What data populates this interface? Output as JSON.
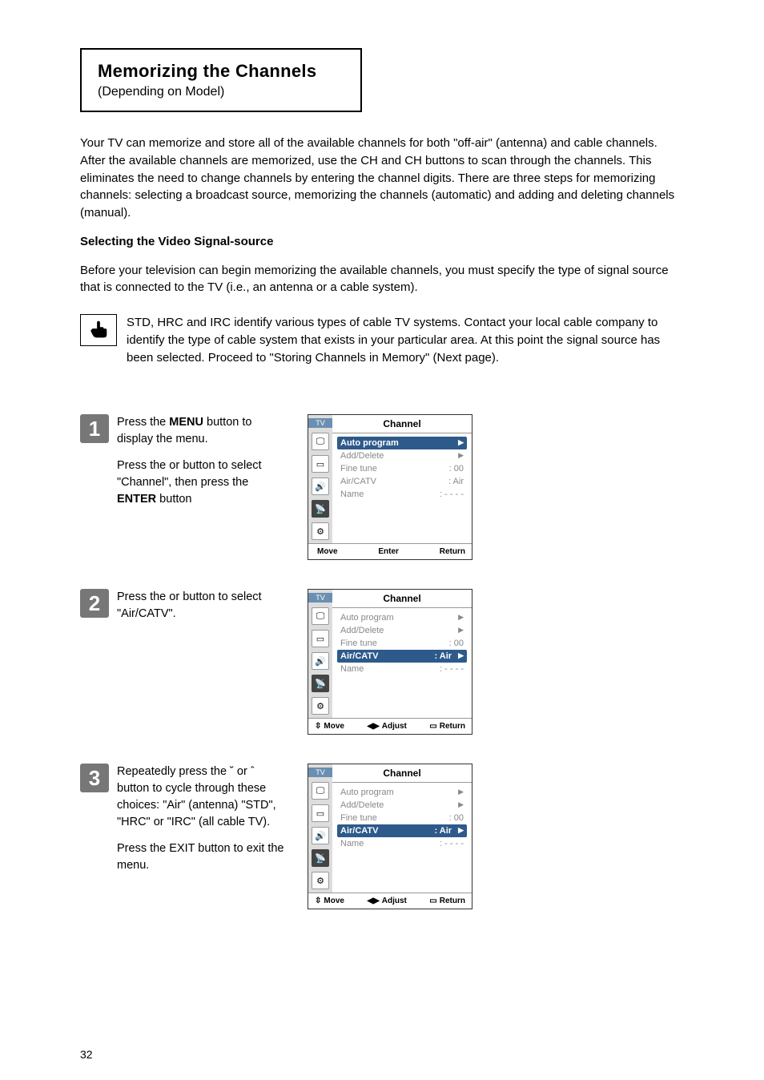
{
  "title": {
    "main": "Memorizing the Channels",
    "sub": "(Depending on Model)"
  },
  "intro": {
    "p1": "Your TV can memorize and store all of the available channels for both \"off-air\" (antenna) and cable channels. After the available channels are memorized, use the CH     and CH      buttons to scan through the channels. This eliminates the need to change channels by entering the channel digits. There are three steps for memorizing channels: selecting a broadcast source, memorizing the channels (automatic) and adding and deleting channels (manual).",
    "heading": "Selecting the Video Signal-source",
    "p2": "Before your television can begin memorizing the available channels, you must specify the type of signal source that is connected to the TV (i.e., an antenna or a cable system)."
  },
  "note": "STD, HRC and IRC identify various types of cable TV systems. Contact your local cable company to identify the type of cable system that exists in your particular area. At this point the signal source has been selected. Proceed to \"Storing Channels in Memory\" (Next page).",
  "steps": [
    {
      "num": "1",
      "paras": [
        "Press the <b>MENU</b> button to display the menu.",
        "Press the     or     button to select \"Channel\", then press the <b>ENTER</b> button"
      ],
      "osd": {
        "title": "Channel",
        "sel_index": 0,
        "items": [
          {
            "label": "Auto program",
            "val": "",
            "arrow": "▶"
          },
          {
            "label": "Add/Delete",
            "val": "",
            "arrow": "▶"
          },
          {
            "label": "Fine tune",
            "val": ":   00",
            "arrow": ""
          },
          {
            "label": "Air/CATV",
            "val": ":   Air",
            "arrow": ""
          },
          {
            "label": "Name",
            "val": ":   - - - -",
            "arrow": ""
          }
        ],
        "footer": {
          "a": "Move",
          "b": "Enter",
          "c": "Return",
          "mode": "enter"
        }
      }
    },
    {
      "num": "2",
      "paras": [
        "Press the     or     button to select \"Air/CATV\"."
      ],
      "osd": {
        "title": "Channel",
        "sel_index": 3,
        "items": [
          {
            "label": "Auto program",
            "val": "",
            "arrow": "▶"
          },
          {
            "label": "Add/Delete",
            "val": "",
            "arrow": "▶"
          },
          {
            "label": "Fine tune",
            "val": ":   00",
            "arrow": ""
          },
          {
            "label": "Air/CATV",
            "val": ":   Air",
            "arrow": "▶"
          },
          {
            "label": "Name",
            "val": ":   - - - -",
            "arrow": ""
          }
        ],
        "footer": {
          "a": "Move",
          "b": "Adjust",
          "c": "Return",
          "mode": "adjust"
        }
      }
    },
    {
      "num": "3",
      "paras": [
        "Repeatedly press the ˘ or ˆ button to cycle through these choices: \"Air\" (antenna) \"STD\", \"HRC\" or \"IRC\" (all cable TV).",
        "Press the EXIT button to exit the menu."
      ],
      "osd": {
        "title": "Channel",
        "sel_index": 3,
        "items": [
          {
            "label": "Auto program",
            "val": "",
            "arrow": "▶"
          },
          {
            "label": "Add/Delete",
            "val": "",
            "arrow": "▶"
          },
          {
            "label": "Fine tune",
            "val": ":   00",
            "arrow": ""
          },
          {
            "label": "Air/CATV",
            "val": ":   Air",
            "arrow": "▶"
          },
          {
            "label": "Name",
            "val": ":   - - - -",
            "arrow": ""
          }
        ],
        "footer": {
          "a": "Move",
          "b": "Adjust",
          "c": "Return",
          "mode": "adjust"
        }
      }
    }
  ],
  "osd_left": {
    "tv": "TV"
  },
  "page_number": "32"
}
